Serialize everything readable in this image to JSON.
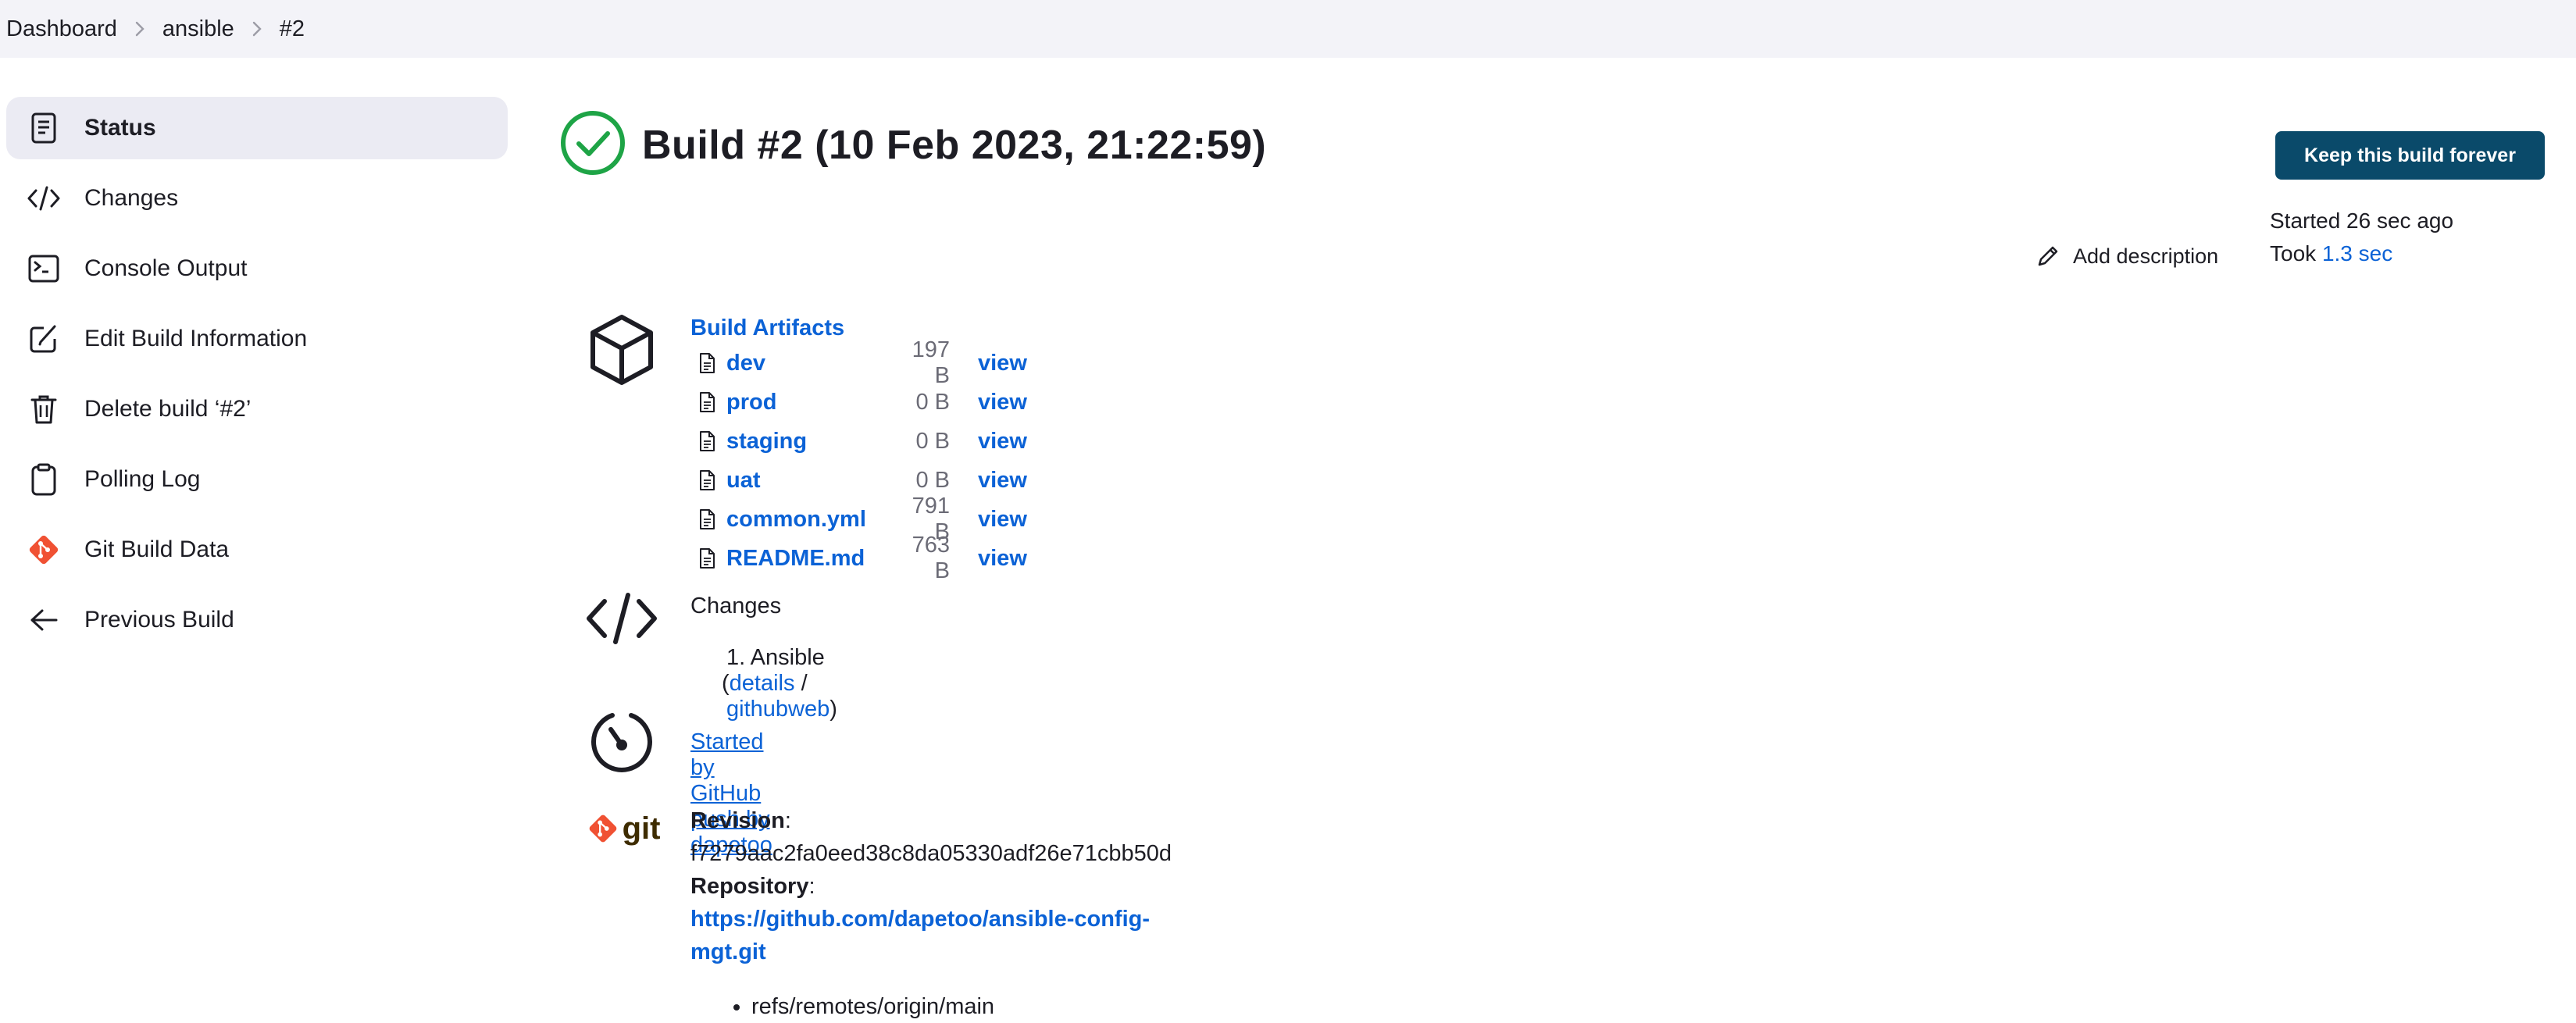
{
  "breadcrumb": [
    "Dashboard",
    "ansible",
    "#2"
  ],
  "sidebar": {
    "items": [
      {
        "label": "Status",
        "icon": "document-icon",
        "active": true
      },
      {
        "label": "Changes",
        "icon": "code-icon"
      },
      {
        "label": "Console Output",
        "icon": "terminal-icon"
      },
      {
        "label": "Edit Build Information",
        "icon": "edit-icon"
      },
      {
        "label": "Delete build ‘#2’",
        "icon": "trash-icon"
      },
      {
        "label": "Polling Log",
        "icon": "clipboard-icon"
      },
      {
        "label": "Git Build Data",
        "icon": "git-icon"
      },
      {
        "label": "Previous Build",
        "icon": "arrow-left-icon"
      }
    ]
  },
  "build": {
    "title": "Build #2 (10 Feb 2023, 21:22:59)",
    "status_color": "#1ea446",
    "keep_label": "Keep this build forever",
    "started": "Started 26 sec ago",
    "took_prefix": "Took ",
    "took_value": "1.3 sec",
    "add_description": "Add description"
  },
  "artifacts": {
    "heading": "Build Artifacts",
    "view_label": "view",
    "files": [
      {
        "name": "dev",
        "size": "197 B"
      },
      {
        "name": "prod",
        "size": "0 B"
      },
      {
        "name": "staging",
        "size": "0 B"
      },
      {
        "name": "uat",
        "size": "0 B"
      },
      {
        "name": "common.yml",
        "size": "791 B"
      },
      {
        "name": "README.md",
        "size": "763 B"
      }
    ]
  },
  "changes": {
    "heading": "Changes",
    "item_number": "1.",
    "item_name": "Ansible",
    "open_paren": "(",
    "details_link": "details",
    "separator": "/",
    "githubweb_link": "githubweb",
    "close_paren": ")"
  },
  "trigger": {
    "text": "Started by GitHub push by dapetoo"
  },
  "git": {
    "logo_text": "git",
    "revision_label": "Revision",
    "revision_value": "f7279aac2fa0eed38c8da05330adf26e71cbb50d",
    "repository_label": "Repository",
    "repository_url": "https://github.com/dapetoo/ansible-config-mgt.git",
    "refs": [
      "refs/remotes/origin/main"
    ],
    "brand_color": "#f05133"
  }
}
